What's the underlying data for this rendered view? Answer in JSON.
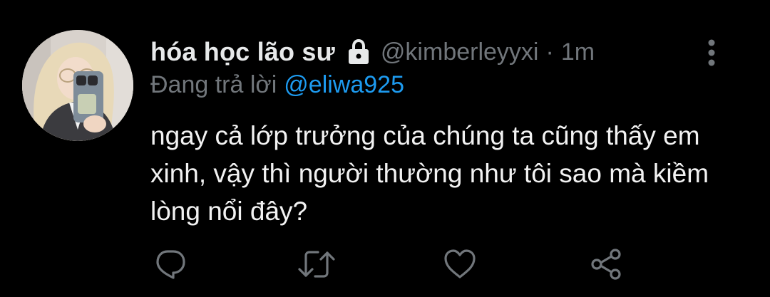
{
  "tweet": {
    "display_name": "hóa học lão sư",
    "handle": "@kimberleyyxi",
    "separator": "·",
    "time": "1m",
    "reply_prefix": "Đang trả lời",
    "reply_to": "@eliwa925",
    "text": "ngay cả lớp trưởng của chúng ta cũng thấy em xinh, vậy thì người thường như tôi sao mà kiềm lòng nổi đây?"
  },
  "icons": {
    "protected": "lock-icon",
    "more": "more-vertical-icon",
    "reply": "reply-icon",
    "retweet": "retweet-icon",
    "like": "heart-icon",
    "share": "share-icon"
  },
  "colors": {
    "background": "#000000",
    "primary_text": "#e7e9ea",
    "secondary_text": "#71767b",
    "mention": "#1d9bf0",
    "icon": "#71767b"
  }
}
